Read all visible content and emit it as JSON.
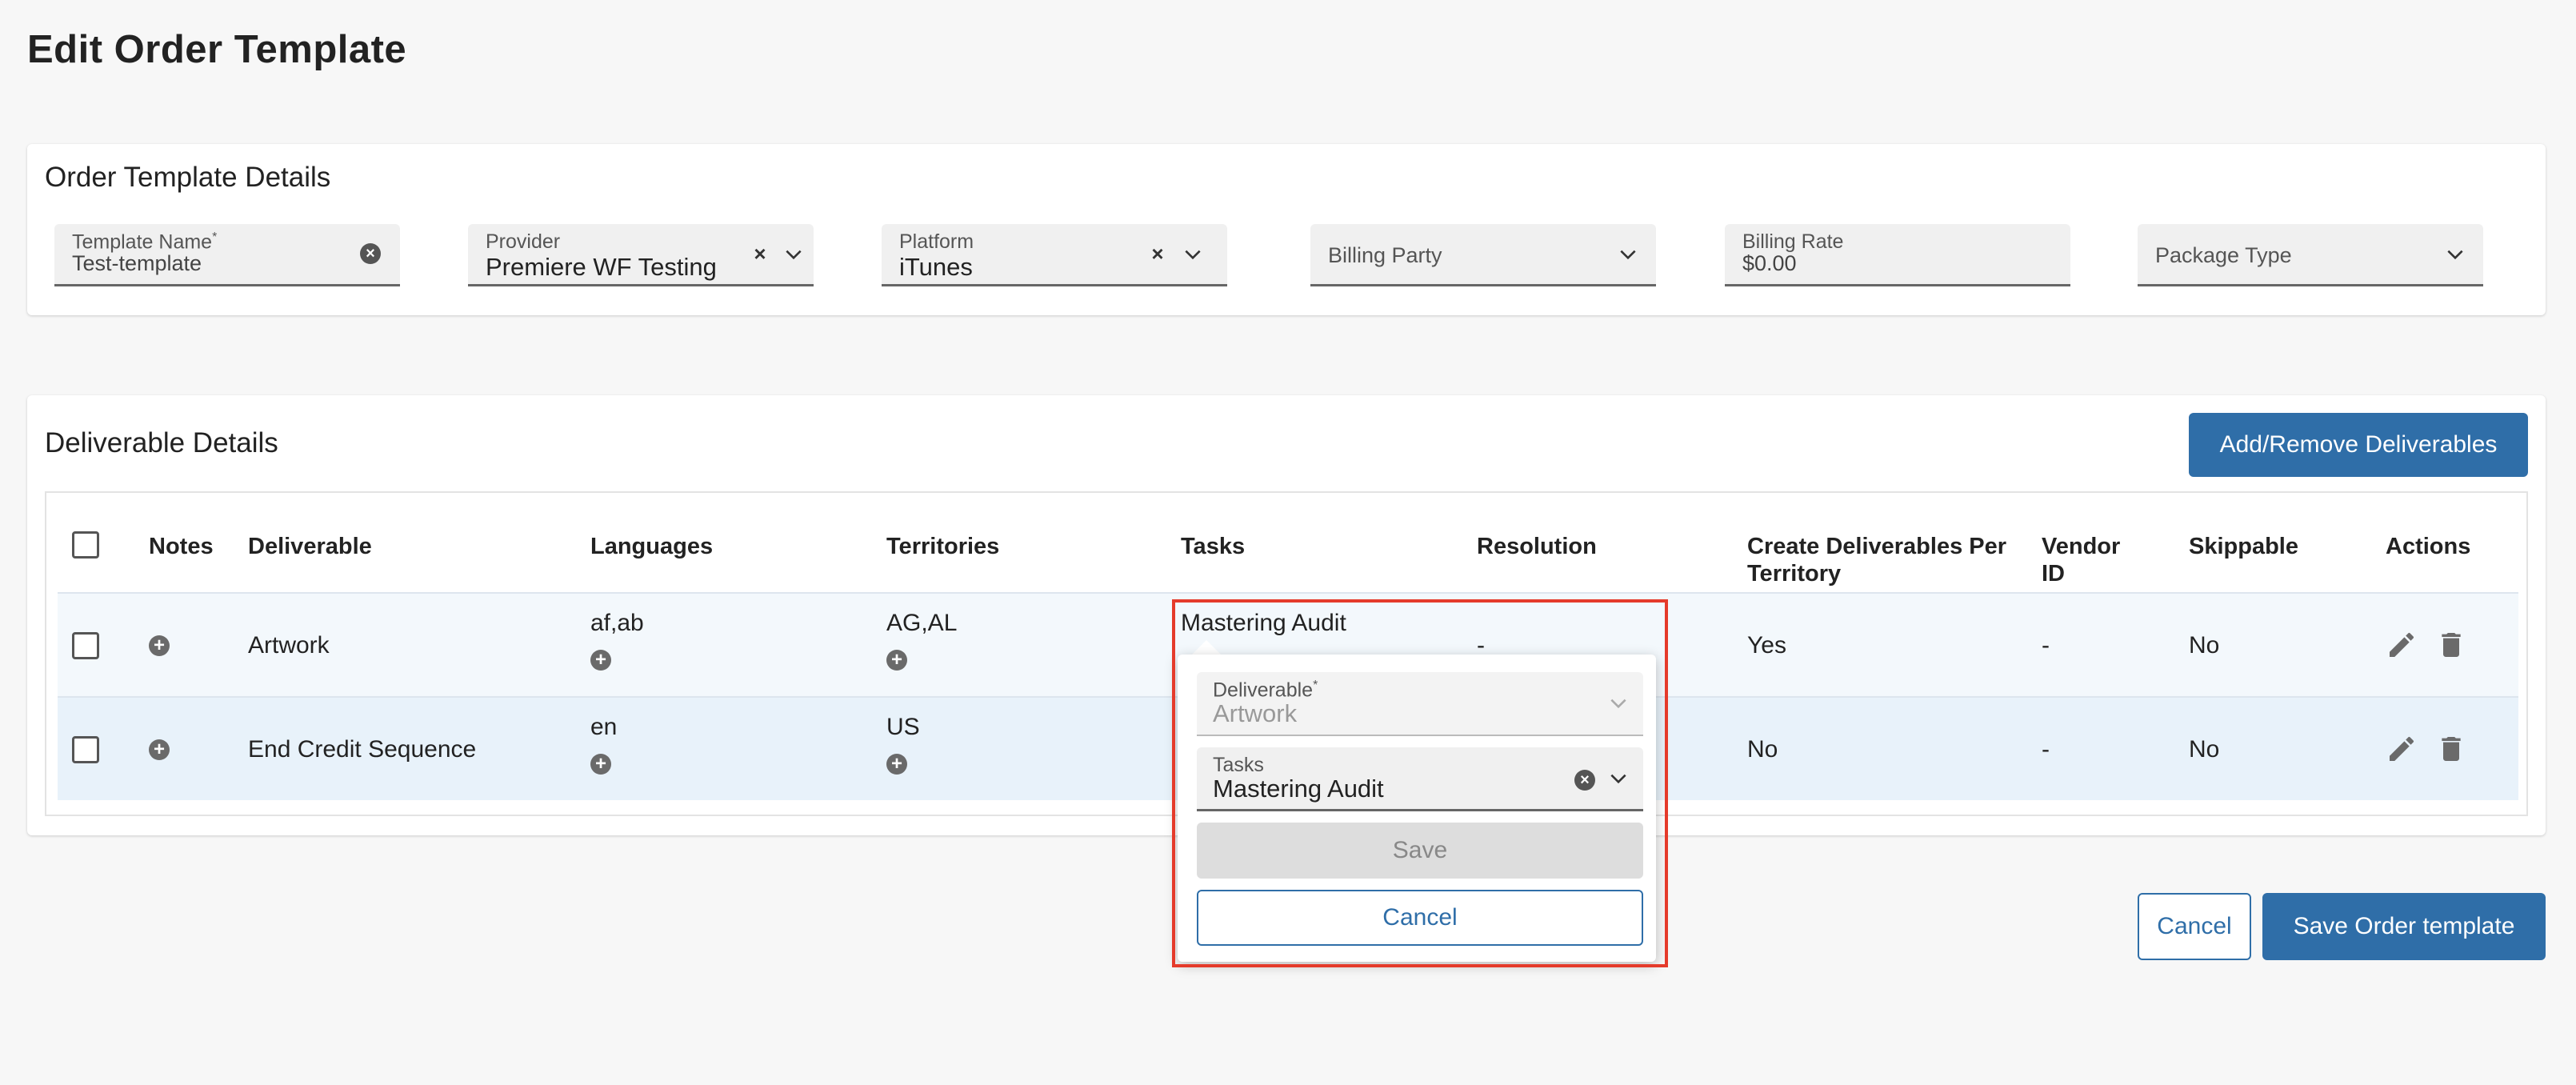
{
  "page": {
    "title": "Edit Order Template"
  },
  "template_details": {
    "title": "Order Template Details",
    "fields": {
      "template_name": {
        "label": "Template Name",
        "required": "*",
        "value": "Test-template"
      },
      "provider": {
        "label": "Provider",
        "value": "Premiere WF Testing"
      },
      "platform": {
        "label": "Platform",
        "value": "iTunes"
      },
      "billing_party": {
        "label": "Billing Party",
        "value": ""
      },
      "billing_rate": {
        "label": "Billing Rate",
        "value": "$0.00"
      },
      "package_type": {
        "label": "Package Type",
        "value": ""
      }
    }
  },
  "deliverables": {
    "title": "Deliverable Details",
    "add_remove_label": "Add/Remove Deliverables",
    "columns": {
      "notes": "Notes",
      "deliverable": "Deliverable",
      "languages": "Languages",
      "territories": "Territories",
      "tasks": "Tasks",
      "resolution": "Resolution",
      "create_per_territory": "Create Deliverables Per Territory",
      "vendor_id": "Vendor ID",
      "skippable": "Skippable",
      "actions": "Actions"
    },
    "rows": [
      {
        "deliverable": "Artwork",
        "languages": "af,ab",
        "territories": "AG,AL",
        "tasks": "Mastering Audit",
        "resolution": "-",
        "create_per_territory": "Yes",
        "vendor_id": "-",
        "skippable": "No"
      },
      {
        "deliverable": "End Credit Sequence",
        "languages": "en",
        "territories": "US",
        "tasks": "",
        "resolution": "",
        "create_per_territory": "No",
        "vendor_id": "-",
        "skippable": "No"
      }
    ]
  },
  "popover": {
    "deliverable": {
      "label": "Deliverable",
      "required": "*",
      "value": "Artwork"
    },
    "tasks": {
      "label": "Tasks",
      "value": "Mastering Audit"
    },
    "save_label": "Save",
    "cancel_label": "Cancel"
  },
  "footer": {
    "cancel_label": "Cancel",
    "save_label": "Save Order template"
  },
  "colors": {
    "primary": "#2f6ea8",
    "highlight": "#e53b2b"
  }
}
